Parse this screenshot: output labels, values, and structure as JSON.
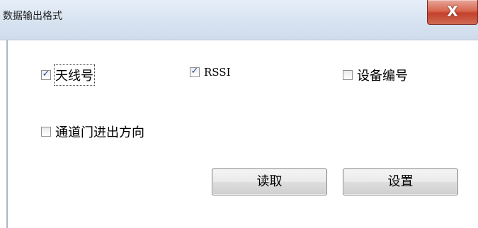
{
  "window": {
    "title": "数据输出格式",
    "close_glyph": "X"
  },
  "checkboxes": [
    {
      "label": "天线号",
      "checked": true,
      "mark": "✓"
    },
    {
      "label": "RSSI",
      "checked": true,
      "mark": "✓"
    },
    {
      "label": "设备编号",
      "checked": false,
      "mark": ""
    },
    {
      "label": "通道门进出方向",
      "checked": false,
      "mark": ""
    }
  ],
  "buttons": {
    "read_label": "读取",
    "set_label": "设置"
  },
  "icons": {
    "close": "close-icon",
    "check": "checkmark-icon"
  }
}
